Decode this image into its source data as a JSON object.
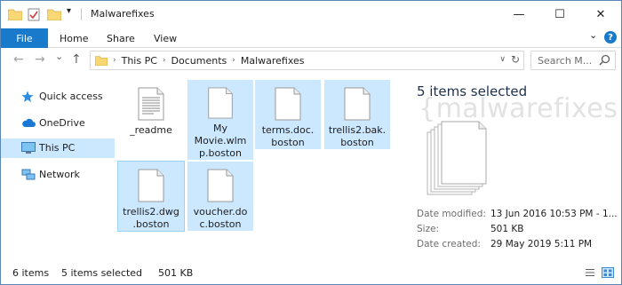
{
  "window": {
    "title": "Malwarefixes",
    "controls": {
      "minimize": "—",
      "maximize": "☐",
      "close": "✕"
    }
  },
  "ribbon": {
    "file": "File",
    "tabs": [
      "Home",
      "Share",
      "View"
    ],
    "expand": "⌄",
    "help": "?"
  },
  "navigation": {
    "back": "←",
    "forward": "→",
    "recent": "⌄",
    "up": "↑",
    "breadcrumbs": [
      "This PC",
      "Documents",
      "Malwarefixes"
    ],
    "search_placeholder": "Search M..."
  },
  "sidebar": {
    "items": [
      {
        "label": "Quick access",
        "icon": "star-icon"
      },
      {
        "label": "OneDrive",
        "icon": "cloud-icon"
      },
      {
        "label": "This PC",
        "icon": "computer-icon",
        "selected": true
      },
      {
        "label": "Network",
        "icon": "network-icon"
      }
    ]
  },
  "files": [
    {
      "name": "_readme",
      "selected": false
    },
    {
      "name": "My Movie.wlmp.boston",
      "selected": true
    },
    {
      "name": "terms.doc.boston",
      "selected": true
    },
    {
      "name": "trellis2.bak.boston",
      "selected": true
    },
    {
      "name": "trellis2.dwg.boston",
      "selected": true
    },
    {
      "name": "voucher.doc.boston",
      "selected": true
    }
  ],
  "file_labels": [
    [
      "_readme"
    ],
    [
      "My",
      "Movie.wlm",
      "p.boston"
    ],
    [
      "terms.doc.",
      "boston"
    ],
    [
      "trellis2.bak.",
      "boston"
    ],
    [
      "trellis2.dwg",
      ".boston"
    ],
    [
      "voucher.do",
      "c.boston"
    ]
  ],
  "details": {
    "selection_summary": "5 items selected",
    "watermark": "{malwarefixes}",
    "properties": [
      {
        "label": "Date modified:",
        "value": "13 Jun 2016 10:53 PM - 1..."
      },
      {
        "label": "Size:",
        "value": "501 KB"
      },
      {
        "label": "Date created:",
        "value": "29 May 2019 5:11 PM"
      }
    ]
  },
  "status": {
    "item_count": "6 items",
    "selected": "5 items selected",
    "size": "501 KB"
  },
  "colors": {
    "accent": "#1979ca",
    "selection": "#cce8ff",
    "folder": "#f8d775"
  }
}
